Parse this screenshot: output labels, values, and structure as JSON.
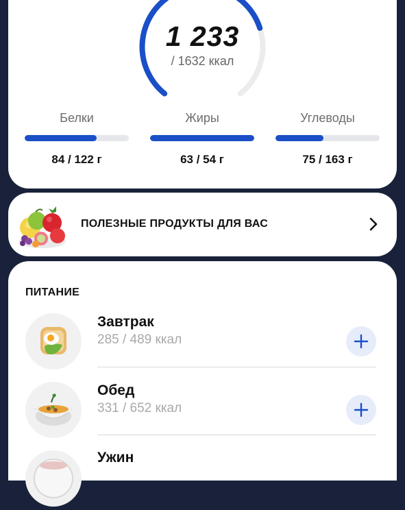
{
  "summary": {
    "kcal_eaten": "1 233",
    "kcal_goal": "/ 1632 ккал",
    "kcal_progress": 0.755,
    "macros": [
      {
        "label": "Белки",
        "value": "84 / 122 г",
        "progress": 0.69
      },
      {
        "label": "Жиры",
        "value": "63 / 54 г",
        "progress": 1.0
      },
      {
        "label": "Углеводы",
        "value": "75 / 163 г",
        "progress": 0.46
      }
    ],
    "accent_color": "#1a4fc7",
    "track_color": "#e5e7eb"
  },
  "promo": {
    "label": "ПОЛЕЗНЫЕ ПРОДУКТЫ ДЛЯ ВАС",
    "icon": "fruits-icon",
    "arrow_icon": "chevron-right-icon"
  },
  "nutrition": {
    "title": "ПИТАНИЕ",
    "meals": [
      {
        "name": "Завтрак",
        "kcal": "285 / 489 ккал",
        "icon": "toast-egg-icon"
      },
      {
        "name": "Обед",
        "kcal": "331 / 652 ккал",
        "icon": "soup-bowl-icon"
      },
      {
        "name": "Ужин",
        "kcal": "",
        "icon": "dinner-plate-icon"
      }
    ]
  }
}
